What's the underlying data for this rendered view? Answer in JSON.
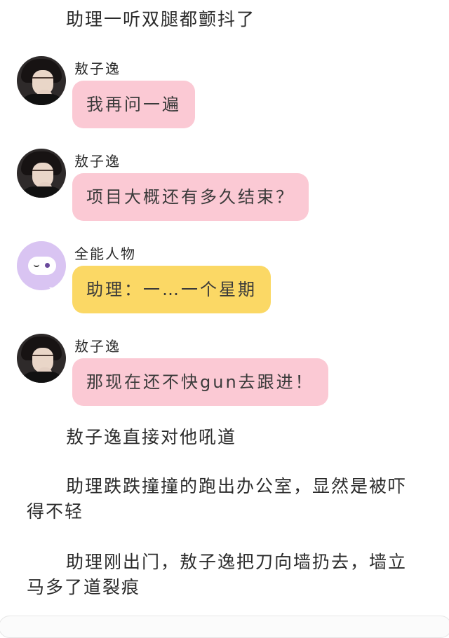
{
  "colors": {
    "pink_bubble": "#fbc9d4",
    "yellow_bubble": "#fbd865",
    "bot_avatar_bg": "#d9c4f2"
  },
  "narration": [
    "助理一听双腿都颤抖了",
    "敖子逸直接对他吼道",
    "助理跌跌撞撞的跑出办公室，显然是被吓得不轻",
    "助理刚出门，敖子逸把刀向墙扔去，墙立马多了道裂痕"
  ],
  "messages": [
    {
      "sender": "敖子逸",
      "text": "我再问一遍",
      "avatar": "person-photo"
    },
    {
      "sender": "敖子逸",
      "text": "项目大概还有多久结束？",
      "avatar": "person-photo"
    },
    {
      "sender": "全能人物",
      "text": "助理：一…一个星期",
      "avatar": "speech-bubble-icon"
    },
    {
      "sender": "敖子逸",
      "text": "那现在还不快gun去跟进！",
      "avatar": "person-photo"
    }
  ]
}
